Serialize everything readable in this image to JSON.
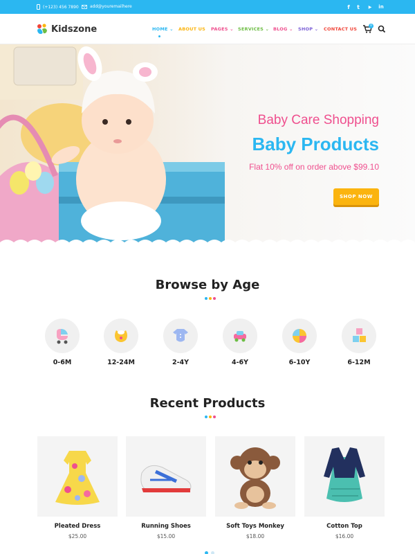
{
  "topbar": {
    "phone": "(+123) 456 7890",
    "email": "add@youremailhere",
    "social": [
      "facebook-icon",
      "twitter-icon",
      "youtube-icon",
      "linkedin-icon"
    ],
    "social_glyphs": [
      "f",
      "t",
      "▶",
      "in"
    ]
  },
  "header": {
    "logo": "Kidszone",
    "nav": [
      {
        "label": "HOME",
        "color": "#2bb7f1",
        "caret": true
      },
      {
        "label": "ABOUT US",
        "color": "#fbb40f",
        "caret": false
      },
      {
        "label": "PAGES",
        "color": "#ef4f8e",
        "caret": true
      },
      {
        "label": "SERVICES",
        "color": "#6dbd44",
        "caret": true
      },
      {
        "label": "BLOG",
        "color": "#ef4f8e",
        "caret": true
      },
      {
        "label": "SHOP",
        "color": "#7b5fd6",
        "caret": true
      },
      {
        "label": "CONTACT US",
        "color": "#f04438",
        "caret": false
      }
    ],
    "cart_count": "0"
  },
  "hero": {
    "subtitle": "Baby Care Shopping",
    "title": "Baby Products",
    "offer": "Flat 10% off on order above $99.10",
    "button": "SHOP NOW"
  },
  "browse": {
    "title": "Browse by Age",
    "ages": [
      {
        "label": "0-6M",
        "icon": "stroller-icon"
      },
      {
        "label": "12-24M",
        "icon": "bib-icon"
      },
      {
        "label": "2-4Y",
        "icon": "onesie-icon"
      },
      {
        "label": "4-6Y",
        "icon": "toy-car-icon"
      },
      {
        "label": "6-10Y",
        "icon": "ball-icon"
      },
      {
        "label": "6-12M",
        "icon": "blocks-icon"
      }
    ]
  },
  "products": {
    "title": "Recent Products",
    "items": [
      {
        "name": "Pleated Dress",
        "price": "$25.00"
      },
      {
        "name": "Running Shoes",
        "price": "$15.00"
      },
      {
        "name": "Soft Toys Monkey",
        "price": "$18.00"
      },
      {
        "name": "Cotton Top",
        "price": "$16.00"
      }
    ]
  },
  "colors": {
    "accent_blue": "#2bb7f1",
    "accent_pink": "#ef4f8e",
    "accent_yellow": "#fbb40f"
  }
}
